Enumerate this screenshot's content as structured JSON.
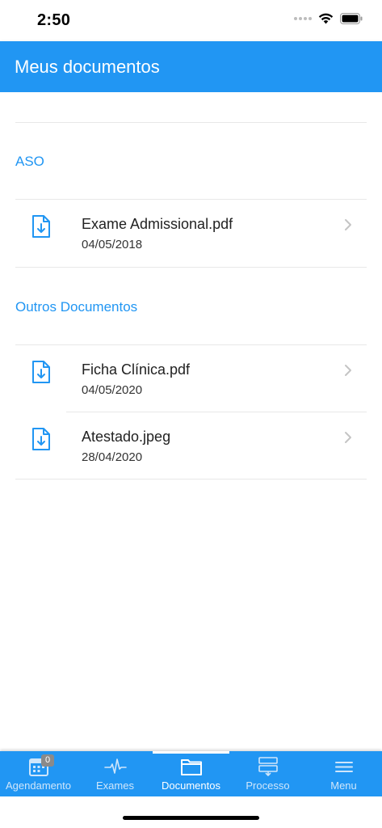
{
  "status_bar": {
    "time": "2:50"
  },
  "header": {
    "title": "Meus documentos"
  },
  "sections": [
    {
      "title": "ASO",
      "documents": [
        {
          "name": "Exame Admissional.pdf",
          "date": "04/05/2018"
        }
      ]
    },
    {
      "title": "Outros Documentos",
      "documents": [
        {
          "name": "Ficha Clínica.pdf",
          "date": "04/05/2020"
        },
        {
          "name": "Atestado.jpeg",
          "date": "28/04/2020"
        }
      ]
    }
  ],
  "tab_bar": {
    "tabs": [
      {
        "label": "Agendamento",
        "icon": "calendar-icon",
        "badge": "0"
      },
      {
        "label": "Exames",
        "icon": "pulse-icon"
      },
      {
        "label": "Documentos",
        "icon": "folder-icon",
        "active": true
      },
      {
        "label": "Processo",
        "icon": "process-flow-icon"
      },
      {
        "label": "Menu",
        "icon": "hamburger-menu-icon"
      }
    ]
  },
  "colors": {
    "primary": "#2196f3",
    "tab_inactive_text": "#cfe6fb",
    "badge": "#8a8a8a"
  }
}
